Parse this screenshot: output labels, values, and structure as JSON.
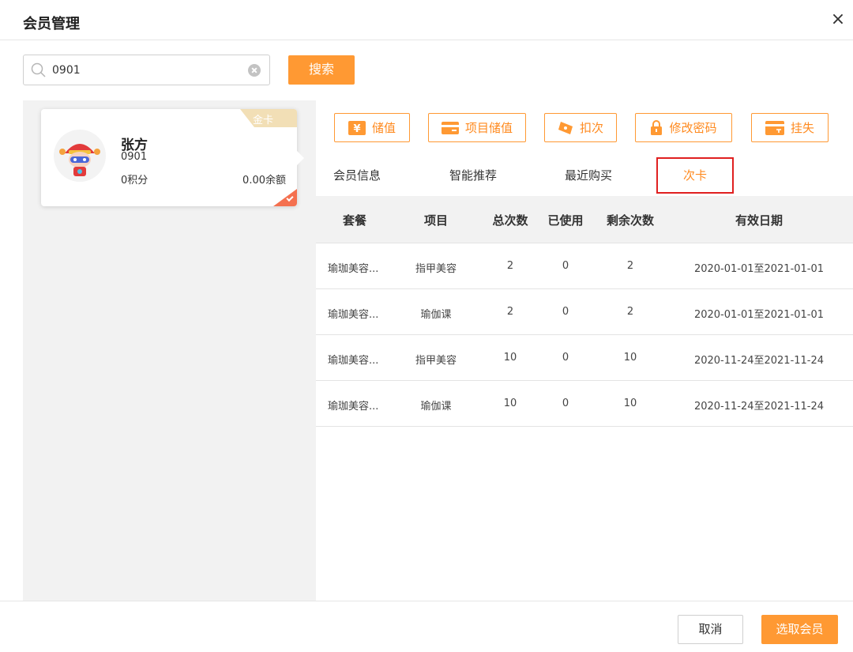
{
  "header": {
    "title": "会员管理",
    "close_label": "×"
  },
  "search": {
    "value": "0901",
    "placeholder": "",
    "button_label": "搜索"
  },
  "member": {
    "name": "张方",
    "id": "0901",
    "points": "0积分",
    "balance": "0.00余额",
    "card_type": "金卡"
  },
  "actions": [
    {
      "label": "储值",
      "icon": "yen-icon"
    },
    {
      "label": "项目储值",
      "icon": "card-icon"
    },
    {
      "label": "扣次",
      "icon": "ticket-icon"
    },
    {
      "label": "修改密码",
      "icon": "lock-icon"
    },
    {
      "label": "挂失",
      "icon": "card-loss-icon"
    }
  ],
  "tabs": [
    {
      "label": "会员信息"
    },
    {
      "label": "智能推荐"
    },
    {
      "label": "最近购买"
    },
    {
      "label": "次卡",
      "active": true
    }
  ],
  "table": {
    "columns": [
      "套餐",
      "项目",
      "总次数",
      "已使用",
      "剩余次数",
      "有效日期"
    ],
    "rows": [
      [
        "瑜珈美容...",
        "指甲美容",
        "2",
        "0",
        "2",
        "2020-01-01至2021-01-01"
      ],
      [
        "瑜珈美容...",
        "瑜伽课",
        "2",
        "0",
        "2",
        "2020-01-01至2021-01-01"
      ],
      [
        "瑜珈美容...",
        "指甲美容",
        "10",
        "0",
        "10",
        "2020-11-24至2021-11-24"
      ],
      [
        "瑜珈美容...",
        "瑜伽课",
        "10",
        "0",
        "10",
        "2020-11-24至2021-11-24"
      ]
    ]
  },
  "footer": {
    "cancel_label": "取消",
    "select_label": "选取会员"
  },
  "colors": {
    "accent": "#ff9933",
    "highlight_border": "#e02020",
    "gold": "#f2dfb6",
    "corner": "#f4704f"
  }
}
